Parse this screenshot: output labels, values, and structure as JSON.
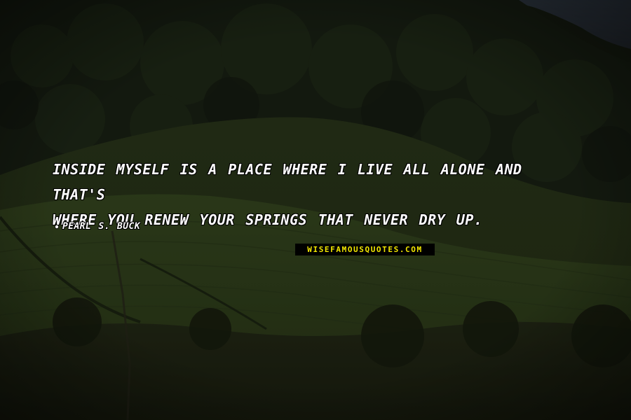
{
  "quote": {
    "line1": "Inside myself is a place where I live all alone and that's",
    "line2": "where you renew your springs that never dry up."
  },
  "author": {
    "name": "Pearl S. Buck"
  },
  "watermark": {
    "text": "WISEFAMOUSQUOTES.COM"
  },
  "colors": {
    "quote_text": "#ffffff",
    "watermark_text": "#f2e600",
    "watermark_bg": "#000000"
  },
  "background": {
    "icon": "hillside-landscape-photo"
  }
}
